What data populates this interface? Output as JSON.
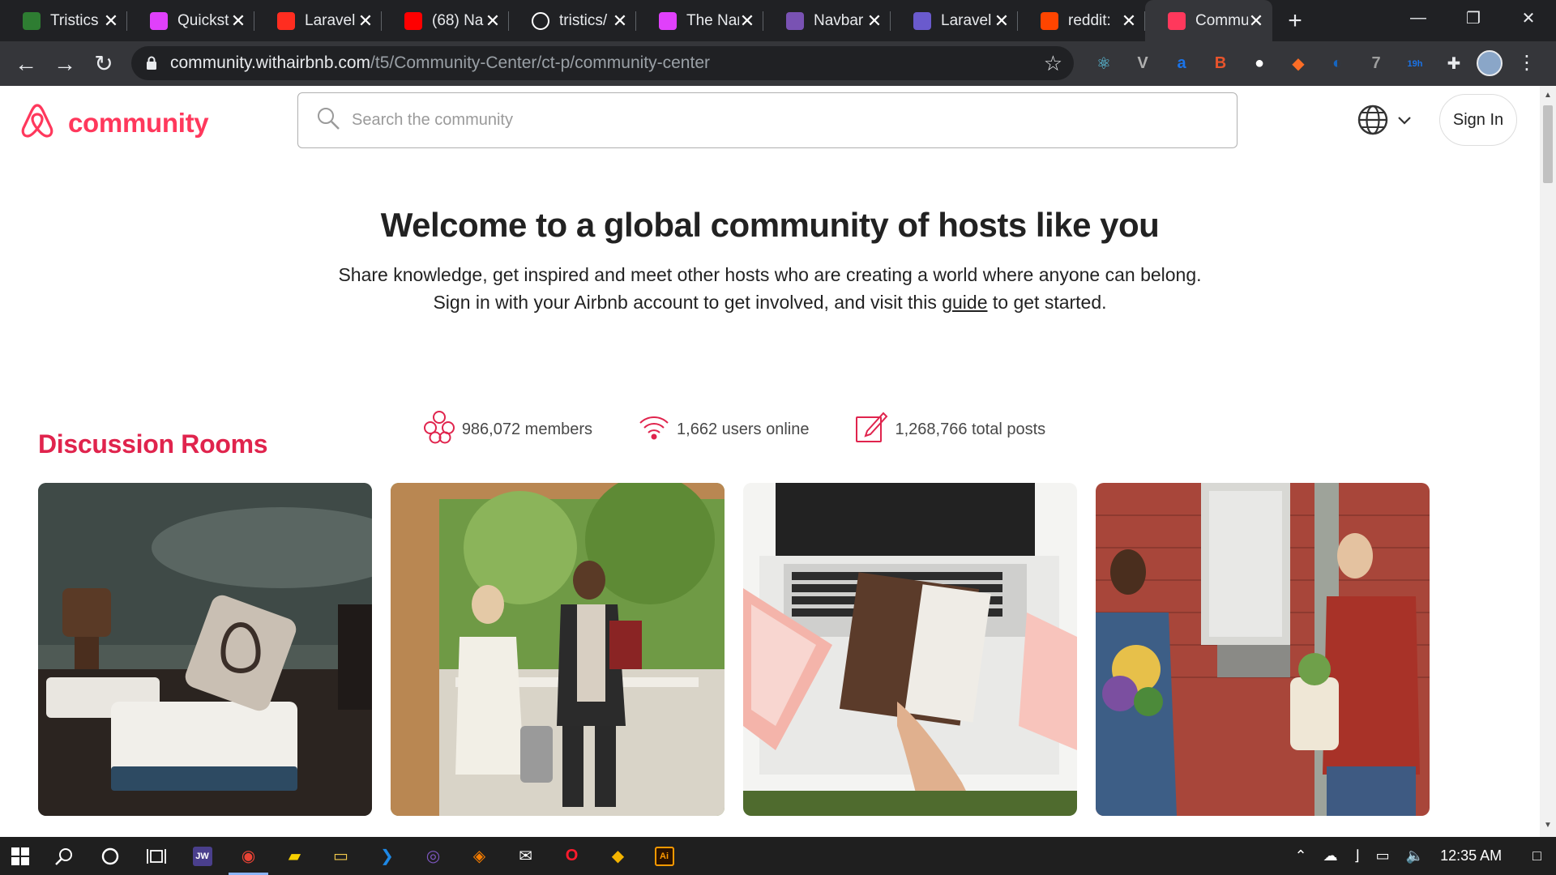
{
  "browser": {
    "tabs": [
      {
        "title": "Tristics",
        "icon": "tristics-icon",
        "color": "#2e7d32"
      },
      {
        "title": "Quickst",
        "icon": "octopus-icon",
        "color": "#e040fb"
      },
      {
        "title": "Laravel",
        "icon": "laravel-icon",
        "color": "#ff2d20"
      },
      {
        "title": "(68) Na",
        "icon": "youtube-icon",
        "color": "#ff0000"
      },
      {
        "title": "tristics/",
        "icon": "github-icon",
        "color": "#ffffff"
      },
      {
        "title": "The Nar",
        "icon": "octopus-icon",
        "color": "#e040fb"
      },
      {
        "title": "Navbar",
        "icon": "bootstrap-icon",
        "color": "#7952b3"
      },
      {
        "title": "Laravel",
        "icon": "laravel-icon",
        "color": "#6a5acd"
      },
      {
        "title": "reddit:",
        "icon": "reddit-icon",
        "color": "#ff4500"
      },
      {
        "title": "Commu",
        "icon": "airbnb-icon",
        "color": "#ff385c",
        "active": true
      }
    ],
    "address": {
      "host": "community.withairbnb.com",
      "path": "/t5/Community-Center/ct-p/community-center"
    },
    "extensions": [
      {
        "name": "react-devtools-icon",
        "label": "⚛",
        "color": "#61dafb"
      },
      {
        "name": "vue-devtools-icon",
        "label": "V",
        "color": "#b0b0b0"
      },
      {
        "name": "extension-a-icon",
        "label": "a",
        "color": "#1a73e8"
      },
      {
        "name": "extension-b-icon",
        "label": "B",
        "color": "#e8542c"
      },
      {
        "name": "github-ext-icon",
        "label": "●",
        "color": "#ffffff"
      },
      {
        "name": "gitlab-ext-icon",
        "label": "◆",
        "color": "#fc6d26"
      },
      {
        "name": "extension-c-icon",
        "label": "◐",
        "color": "#1565c0"
      },
      {
        "name": "mail-ext-icon",
        "label": "7",
        "color": "#9e9e9e"
      },
      {
        "name": "timer-ext-icon",
        "label": "19h",
        "color": "#1a73e8"
      },
      {
        "name": "puzzle-icon",
        "label": "✚",
        "color": "#e8eaed"
      }
    ]
  },
  "site": {
    "logo_text": "community",
    "search_placeholder": "Search the community",
    "signin_label": "Sign In",
    "hero": {
      "title": "Welcome to a global community of hosts like you",
      "line1": "Share knowledge, get inspired and meet other hosts who are creating a world where anyone can belong.",
      "line2_before": "Sign in with your Airbnb account to get involved, and visit this ",
      "line2_link": "guide",
      "line2_after": " to get started."
    },
    "stats": {
      "members": "986,072 members",
      "online": "1,662 users online",
      "posts": "1,268,766 total posts"
    },
    "rooms_title": "Discussion Rooms",
    "cards": [
      "Airbnb stamp",
      "Host greeting guest",
      "Laptop with booklet",
      "Two neighbors with flowers"
    ]
  },
  "taskbar": {
    "clock": "12:35 AM",
    "apps": [
      {
        "name": "jw-app-icon",
        "label": "JW",
        "color": "#4a3f8c"
      },
      {
        "name": "chrome-icon",
        "label": "◉",
        "color": "#ea4335",
        "active": true
      },
      {
        "name": "sticky-notes-icon",
        "label": "▰",
        "color": "#f7d000"
      },
      {
        "name": "file-explorer-icon",
        "label": "▭",
        "color": "#f2c94c"
      },
      {
        "name": "vscode-icon",
        "label": "❯",
        "color": "#1e88e5"
      },
      {
        "name": "app-purple-icon",
        "label": "◎",
        "color": "#7e57c2"
      },
      {
        "name": "app-orange-icon",
        "label": "◈",
        "color": "#f57c00"
      },
      {
        "name": "mail-icon",
        "label": "✉",
        "color": "#ffffff"
      },
      {
        "name": "opera-icon",
        "label": "O",
        "color": "#ff1b2d"
      },
      {
        "name": "git-icon",
        "label": "◆",
        "color": "#f4b400"
      },
      {
        "name": "illustrator-icon",
        "label": "Ai",
        "color": "#ff9a00"
      }
    ]
  },
  "colors": {
    "brand": "#ff385c",
    "rooms_title": "#e0244d",
    "chrome_dark": "#202124",
    "chrome_toolbar": "#35363a"
  }
}
